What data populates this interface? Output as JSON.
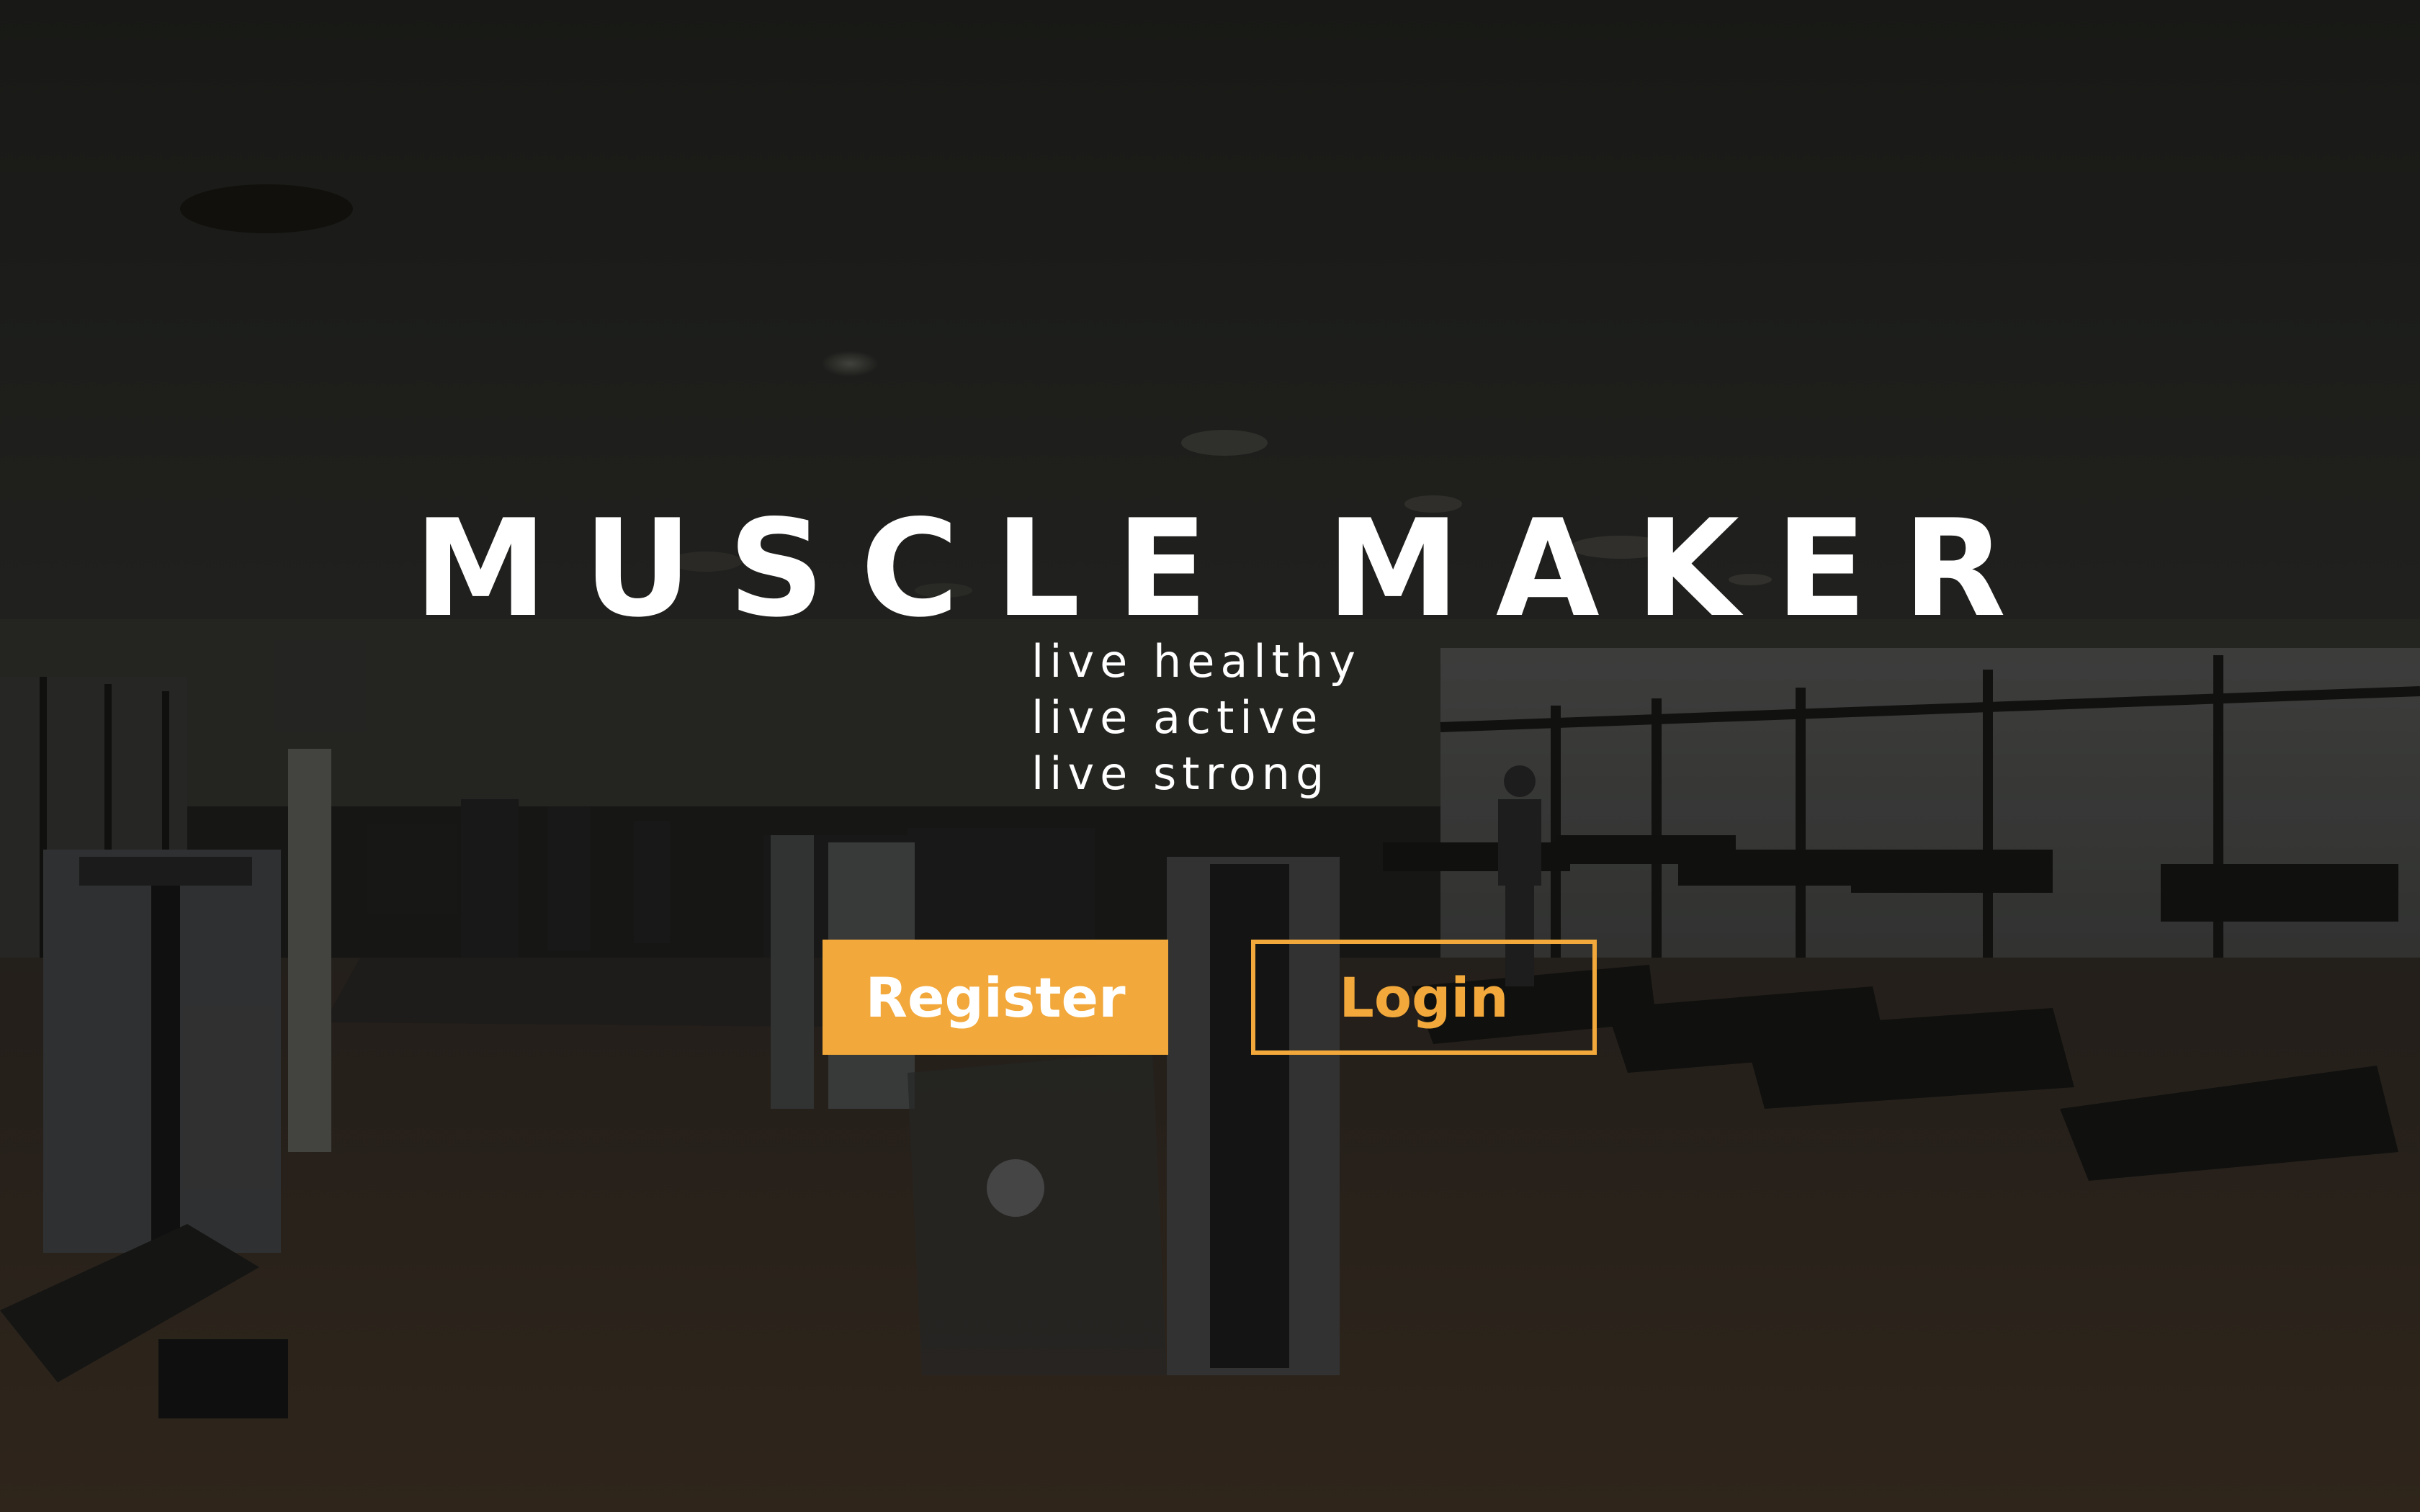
{
  "app": {
    "title": "MUSCLE MAKER",
    "tagline": [
      "live healthy",
      "live active",
      "live strong"
    ]
  },
  "actions": {
    "register_label": "Register",
    "login_label": "Login"
  },
  "colors": {
    "accent": "#f2a83a",
    "text": "#ffffff",
    "background": "#1c1c1a"
  },
  "background": {
    "subject": "gym interior with weight machines and treadmills (dimmed)"
  }
}
